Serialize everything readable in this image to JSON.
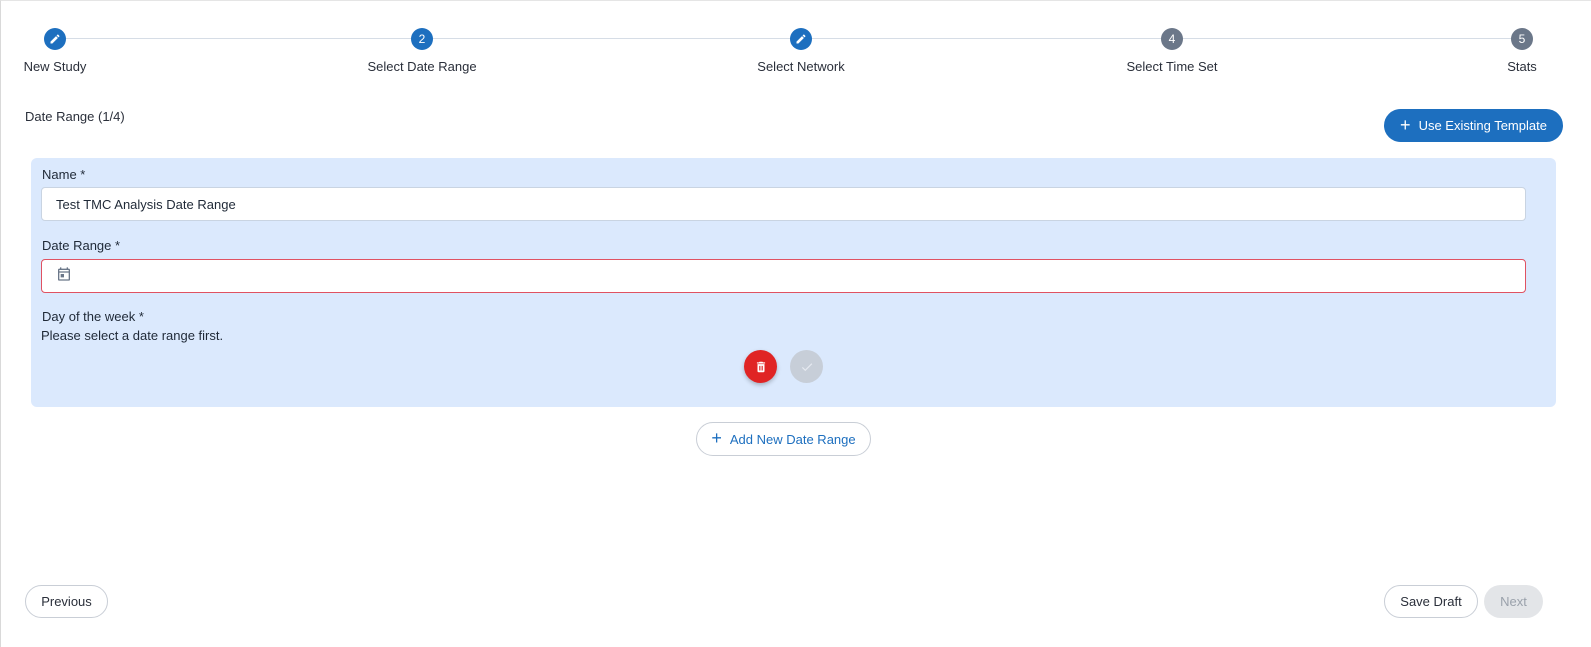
{
  "stepper": {
    "steps": [
      {
        "label": "New Study",
        "marker": "",
        "state": "done",
        "icon": "pencil-icon"
      },
      {
        "label": "Select Date Range",
        "marker": "2",
        "state": "current"
      },
      {
        "label": "Select Network",
        "marker": "",
        "state": "done",
        "icon": "pencil-icon"
      },
      {
        "label": "Select Time Set",
        "marker": "4",
        "state": "pending"
      },
      {
        "label": "Stats",
        "marker": "5",
        "state": "pending"
      }
    ]
  },
  "section": {
    "title": "Date Range (1/4)"
  },
  "template_button": {
    "label": "Use Existing Template",
    "icon": "plus-icon"
  },
  "form": {
    "name_label": "Name *",
    "name_value": "Test TMC Analysis Date Range",
    "date_range_label": "Date Range *",
    "date_range_value": "",
    "date_range_icon": "calendar-icon",
    "day_of_week_label": "Day of the week *",
    "day_of_week_helper": "Please select a date range first.",
    "delete_icon": "trash-icon",
    "confirm_icon": "check-icon"
  },
  "add_range_button": {
    "label": "Add New Date Range",
    "icon": "plus-icon"
  },
  "footer": {
    "previous_label": "Previous",
    "save_draft_label": "Save Draft",
    "next_label": "Next"
  },
  "colors": {
    "accent": "#1d6fbf",
    "pending_step": "#6b7789",
    "card_background": "#dbe9fd",
    "error_border": "#e05262",
    "delete": "#e02424"
  }
}
